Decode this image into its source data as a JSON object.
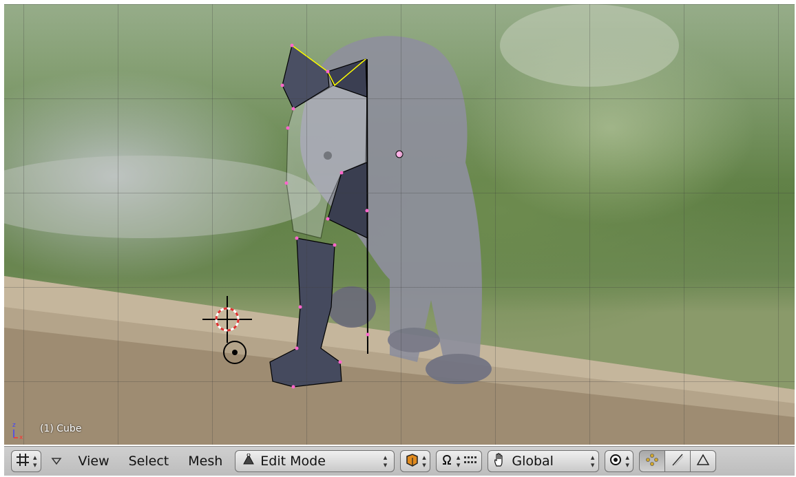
{
  "viewport": {
    "object_label": "(1) Cube",
    "axis_labels": {
      "z": "z",
      "x": "x"
    }
  },
  "header": {
    "menus": [
      {
        "label": "View"
      },
      {
        "label": "Select"
      },
      {
        "label": "Mesh"
      }
    ],
    "mode": {
      "selected": "Edit Mode",
      "icon": "edit-mode-triangle-icon"
    },
    "transform_orientation": {
      "selected": "Global",
      "icon": "hand-icon"
    },
    "icons": {
      "editor_type": "grid-icon",
      "menu_collapse": "triangle-down-icon",
      "viewport_shading": "solid-cube-icon",
      "manipulator": "manipulator-omega-icon",
      "layers": "layers-dots-icon",
      "pivot": "pivot-circle-icon",
      "vertex_select": "vertex-select-icon",
      "edge_select": "edge-select-icon",
      "face_select": "face-select-icon"
    }
  },
  "colors": {
    "header_bg": "#c6c6c6",
    "mesh_vertex": "#ff66cc",
    "mesh_selected_edge": "#ffff00",
    "cursor_red": "#e03030"
  }
}
